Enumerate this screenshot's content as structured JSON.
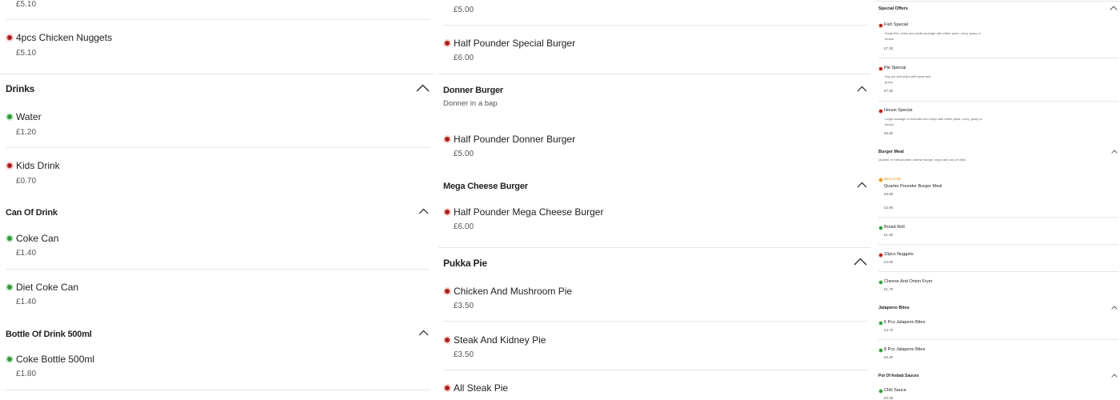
{
  "column1": {
    "top_price": "£5.10",
    "items_a": [
      {
        "name": "4pcs Chicken Nuggets",
        "price": "£5.10",
        "dot": "red"
      }
    ],
    "drinks": {
      "title": "Drinks"
    },
    "drinks_items": [
      {
        "name": "Water",
        "price": "£1.20",
        "dot": "green"
      },
      {
        "name": "Kids Drink",
        "price": "£0.70",
        "dot": "red"
      }
    ],
    "can": {
      "title": "Can Of Drink"
    },
    "can_items": [
      {
        "name": "Coke Can",
        "price": "£1.40",
        "dot": "green"
      },
      {
        "name": "Diet Coke Can",
        "price": "£1.40",
        "dot": "green"
      }
    ],
    "bottle": {
      "title": "Bottle Of Drink 500ml"
    },
    "bottle_items": [
      {
        "name": "Coke Bottle 500ml",
        "price": "£1.80",
        "dot": "green"
      }
    ]
  },
  "column2": {
    "top_price": "£5.00",
    "item_special": {
      "name": "Half Pounder Special Burger",
      "price": "£6.00",
      "dot": "red"
    },
    "donner": {
      "title": "Donner Burger",
      "subtitle": "Donner in a bap"
    },
    "item_donner": {
      "name": "Half Pounder Donner Burger",
      "price": "£5.00",
      "dot": "red"
    },
    "mega": {
      "title": "Mega Cheese Burger"
    },
    "item_mega": {
      "name": "Half Pounder Mega Cheese Burger",
      "price": "£6.00",
      "dot": "red"
    },
    "pukka": {
      "title": "Pukka Pie"
    },
    "pukka_items": [
      {
        "name": "Chicken And Mushroom Pie",
        "price": "£3.50",
        "dot": "red"
      },
      {
        "name": "Steak And Kidney Pie",
        "price": "£3.50",
        "dot": "red"
      },
      {
        "name": "All Steak Pie",
        "price": "",
        "dot": "red"
      }
    ]
  },
  "column3": {
    "special": {
      "title": "Special Offers"
    },
    "special_items": [
      {
        "name": "Fish Special",
        "desc1": "Small fish, chips and small sausage with either peas, curry, gravy or",
        "desc2": "beans.",
        "price": "£7.30",
        "dot": "red"
      },
      {
        "name": "Pie Special",
        "desc1": "Any pie and chips with peas and",
        "desc2": "gravy.",
        "price": "£7.00",
        "dot": "red"
      },
      {
        "name": "House Special",
        "desc1": "Large sausage or fishcake and chips with either peas, curry, gravy or",
        "desc2": "beans.",
        "price": "£5.50",
        "dot": "red"
      }
    ],
    "burger_meal": {
      "title": "Burger Meal",
      "subtitle": "Quarter or half pounder cheese burger, chips and can of drink"
    },
    "burger_meal_item": {
      "badge": "Best Seller",
      "name": "Quarter Pounder Burger Meal",
      "price": "£6.60",
      "dot": "orange"
    },
    "burger_meal_extra": {
      "price": "£2.90"
    },
    "extras": [
      {
        "name": "Bread Roll",
        "price": "£1.00",
        "dot": "green"
      },
      {
        "name": "10pcs Nuggets",
        "price": "£4.80",
        "dot": "red"
      },
      {
        "name": "Cheese And Onion Fryer",
        "price": "£1.70",
        "dot": "green"
      }
    ],
    "jalapeno": {
      "title": "Jalapeno Bites"
    },
    "jalapeno_items": [
      {
        "name": "6 Pcs Jalapeno Bites",
        "price": "£4.70",
        "dot": "green"
      },
      {
        "name": "8 Pcs Jalapeno Bites",
        "price": "£6.20",
        "dot": "green"
      }
    ],
    "pot": {
      "title": "Pot Of Kebab Sauces"
    },
    "pot_items": [
      {
        "name": "Chili Sauce",
        "price": "£0.30",
        "dot": "green"
      }
    ],
    "icons": [
      "chevron-up-icon",
      "circle-dot-icon"
    ],
    "colors": {
      "red_dot": "#b11d1d",
      "green_dot": "#2e9a3a",
      "best_seller": "#e59a1a",
      "divider": "#e4e4e4"
    }
  }
}
